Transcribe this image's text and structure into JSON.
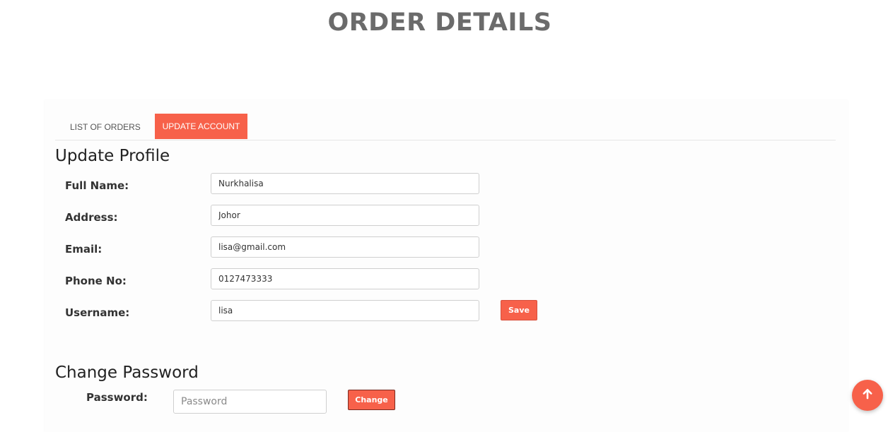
{
  "header": {
    "title": "ORDER DETAILS"
  },
  "tabs": [
    {
      "label": "LIST OF ORDERS",
      "active": false
    },
    {
      "label": "UPDATE ACCOUNT",
      "active": true
    }
  ],
  "profile": {
    "title": "Update Profile",
    "fields": [
      {
        "label": "Full Name:",
        "value": "Nurkhalisa"
      },
      {
        "label": "Address:",
        "value": "Johor"
      },
      {
        "label": "Email:",
        "value": "lisa@gmail.com"
      },
      {
        "label": "Phone No:",
        "value": "0127473333"
      },
      {
        "label": "Username:",
        "value": "lisa"
      }
    ],
    "save_label": "Save"
  },
  "password": {
    "title": "Change Password",
    "label": "Password:",
    "placeholder": "Password",
    "value": "",
    "change_label": "Change"
  },
  "scroll_top": {
    "icon": "arrow-up-icon"
  },
  "colors": {
    "accent": "#f7614a",
    "title_gray": "#6b6b6b"
  }
}
